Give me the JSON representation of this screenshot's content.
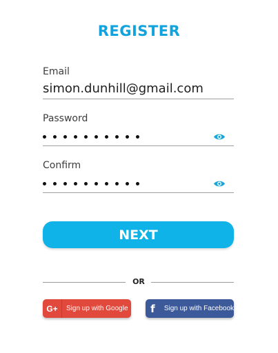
{
  "page": {
    "title": "REGISTER"
  },
  "form": {
    "email": {
      "label": "Email",
      "value": "simon.dunhill@gmail.com"
    },
    "password": {
      "label": "Password",
      "masked_length": 10,
      "toggle_icon": "eye-icon"
    },
    "confirm": {
      "label": "Confirm",
      "masked_length": 10,
      "toggle_icon": "eye-icon"
    }
  },
  "actions": {
    "next_label": "NEXT",
    "divider_text": "OR",
    "google": {
      "icon": "G+",
      "label": "Sign up with Google"
    },
    "facebook": {
      "icon": "f",
      "label": "Sign up with Facebook"
    }
  },
  "colors": {
    "accent": "#12a3dc",
    "button": "#0fb3e8",
    "google": "#e0493c",
    "facebook": "#3c5a9a"
  }
}
